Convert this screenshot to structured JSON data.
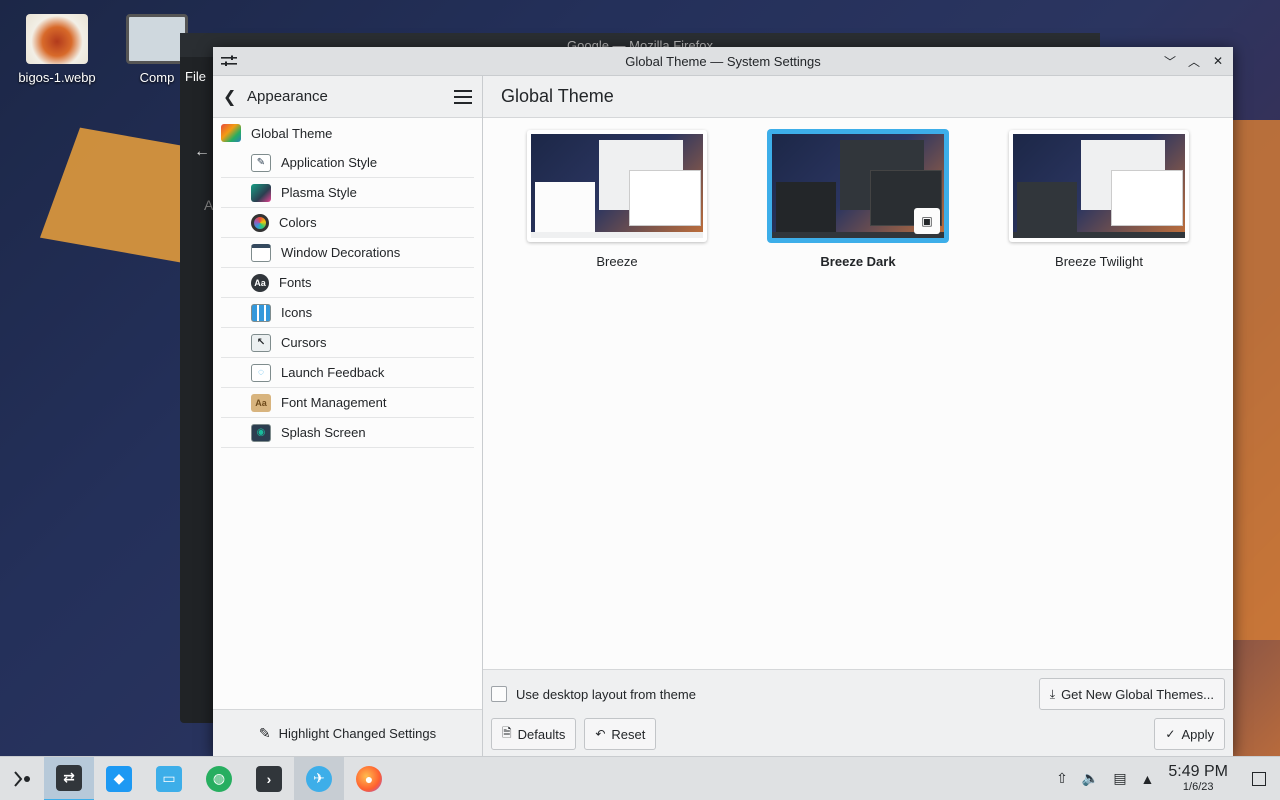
{
  "desktop": {
    "icons": [
      {
        "label": "bigos-1.webp"
      },
      {
        "label": "Comp"
      }
    ],
    "bg_window_title": "Google — Mozilla Firefox",
    "bg_file_label": "File",
    "bg_letter": "A"
  },
  "window": {
    "title": "Global Theme — System Settings",
    "controls": {
      "minimize": "﹀",
      "maximize": "︿",
      "close": "✕"
    }
  },
  "sidebar": {
    "back_glyph": "❮",
    "header": "Appearance",
    "items": [
      {
        "label": "Global Theme",
        "icon": "global-theme-icon"
      },
      {
        "label": "Application Style",
        "icon": "application-style-icon"
      },
      {
        "label": "Plasma Style",
        "icon": "plasma-style-icon"
      },
      {
        "label": "Colors",
        "icon": "colors-icon"
      },
      {
        "label": "Window Decorations",
        "icon": "window-decorations-icon"
      },
      {
        "label": "Fonts",
        "icon": "fonts-icon",
        "glyph": "Aa"
      },
      {
        "label": "Icons",
        "icon": "icons-icon"
      },
      {
        "label": "Cursors",
        "icon": "cursors-icon"
      },
      {
        "label": "Launch Feedback",
        "icon": "launch-feedback-icon"
      },
      {
        "label": "Font Management",
        "icon": "font-management-icon",
        "glyph": "Aa"
      },
      {
        "label": "Splash Screen",
        "icon": "splash-screen-icon"
      }
    ],
    "footer": "Highlight Changed Settings"
  },
  "content": {
    "title": "Global Theme",
    "themes": [
      {
        "name": "Breeze",
        "selected": false,
        "variant": "light"
      },
      {
        "name": "Breeze Dark",
        "selected": true,
        "variant": "dark"
      },
      {
        "name": "Breeze Twilight",
        "selected": false,
        "variant": "twilight"
      }
    ],
    "checkbox_label": "Use desktop layout from theme",
    "get_new_label": "Get New Global Themes...",
    "defaults_label": "Defaults",
    "reset_label": "Reset",
    "apply_label": "Apply"
  },
  "taskbar": {
    "time": "5:49 PM",
    "date": "1/6/23"
  },
  "colors": {
    "accent": "#3daee9",
    "panel": "#eff0f1",
    "view": "#fcfcfc"
  }
}
